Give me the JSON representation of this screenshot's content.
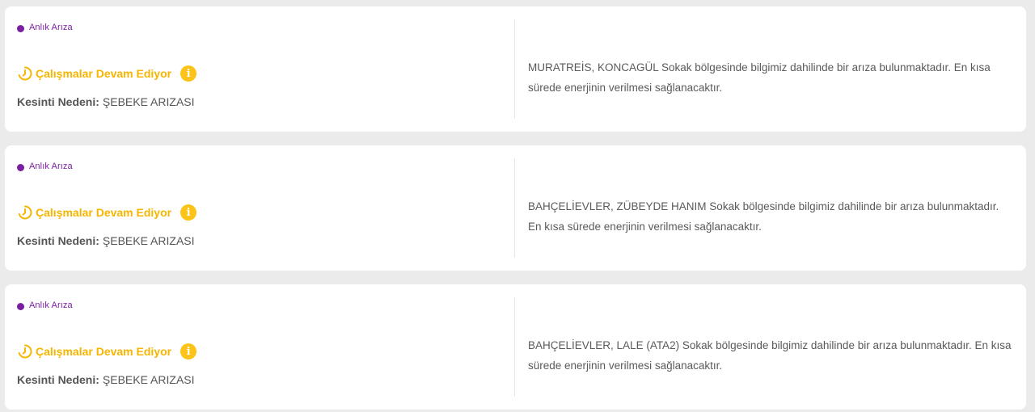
{
  "outages": [
    {
      "type_label": "Anlık Arıza",
      "status_label": "Çalışmalar Devam Ediyor",
      "reason_key": "Kesinti Nedeni:",
      "reason_value": "ŞEBEKE ARIZASI",
      "description": "MURATREİS, KONCAGÜL Sokak bölgesinde bilgimiz dahilinde bir arıza bulunmaktadır. En kısa sürede enerjinin verilmesi sağlanacaktır."
    },
    {
      "type_label": "Anlık Arıza",
      "status_label": "Çalışmalar Devam Ediyor",
      "reason_key": "Kesinti Nedeni:",
      "reason_value": "ŞEBEKE ARIZASI",
      "description": "BAHÇELİEVLER, ZÜBEYDE HANIM Sokak bölgesinde bilgimiz dahilinde bir arıza bulunmaktadır. En kısa sürede enerjinin verilmesi sağlanacaktır."
    },
    {
      "type_label": "Anlık Arıza",
      "status_label": "Çalışmalar Devam Ediyor",
      "reason_key": "Kesinti Nedeni:",
      "reason_value": "ŞEBEKE ARIZASI",
      "description": "BAHÇELİEVLER, LALE (ATA2) Sokak bölgesinde bilgimiz dahilinde bir arıza bulunmaktadır. En kısa sürede enerjinin verilmesi sağlanacaktır."
    }
  ],
  "icons": {
    "type_dot": "status-dot",
    "status": "clock-progress-icon",
    "info": "info-icon"
  },
  "colors": {
    "type": "#7a1fa2",
    "status": "#f7b500",
    "info": "#fcc419",
    "background": "#ebebec",
    "card": "#ffffff"
  }
}
